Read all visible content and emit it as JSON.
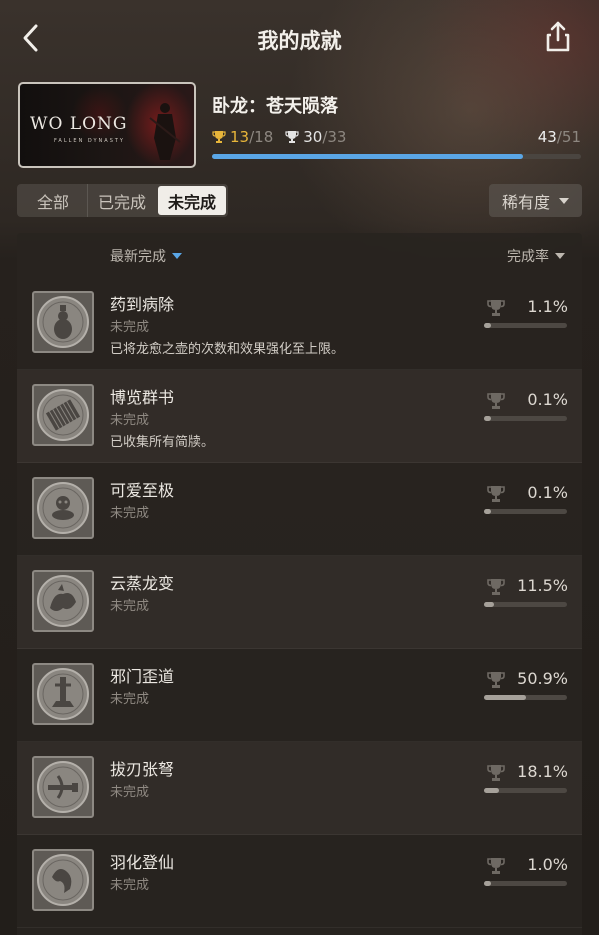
{
  "header": {
    "title": "我的成就",
    "back_icon": "chevron-left-icon",
    "share_icon": "share-icon"
  },
  "game": {
    "name": "卧龙：苍天陨落",
    "cover_logo": "WO LONG",
    "cover_sub": "FALLEN DYNASTY",
    "gold_done": "13",
    "gold_total": "/18",
    "silver_done": "30",
    "silver_total": "/33",
    "overall_done": "43",
    "overall_total": "/51",
    "progress_fraction": 0.843,
    "colors": {
      "gold": "#e7b53a",
      "progress": "#5aa6e6"
    }
  },
  "tabs": [
    {
      "label": "全部",
      "active": false
    },
    {
      "label": "已完成",
      "active": false
    },
    {
      "label": "未完成",
      "active": true
    }
  ],
  "rarity_filter": {
    "label": "稀有度"
  },
  "list": {
    "sort_latest": "最新完成",
    "sort_rate": "完成率",
    "items": [
      {
        "name": "药到病除",
        "status": "未完成",
        "desc": "已将龙愈之壶的次数和效果强化至上限。",
        "rate": "1.1%",
        "rate_value": 1.1,
        "icon": "gourd-icon"
      },
      {
        "name": "博览群书",
        "status": "未完成",
        "desc": "已收集所有简牍。",
        "rate": "0.1%",
        "rate_value": 0.1,
        "icon": "scroll-icon"
      },
      {
        "name": "可爱至极",
        "status": "未完成",
        "desc": "",
        "rate": "0.1%",
        "rate_value": 0.1,
        "icon": "spirit-creature-icon"
      },
      {
        "name": "云蒸龙变",
        "status": "未完成",
        "desc": "",
        "rate": "11.5%",
        "rate_value": 11.5,
        "icon": "dragon-icon"
      },
      {
        "name": "邪门歪道",
        "status": "未完成",
        "desc": "",
        "rate": "50.9%",
        "rate_value": 50.9,
        "icon": "pillar-icon"
      },
      {
        "name": "拔刃张弩",
        "status": "未完成",
        "desc": "",
        "rate": "18.1%",
        "rate_value": 18.1,
        "icon": "crossbow-icon"
      },
      {
        "name": "羽化登仙",
        "status": "未完成",
        "desc": "",
        "rate": "1.0%",
        "rate_value": 1.0,
        "icon": "feather-icon"
      }
    ]
  }
}
